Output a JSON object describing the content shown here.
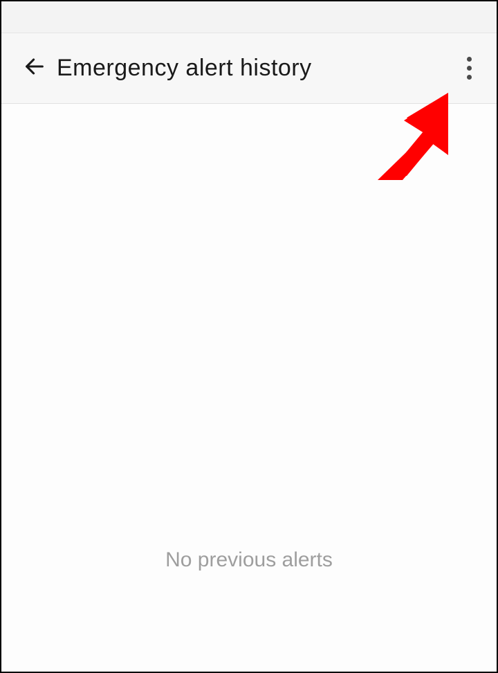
{
  "header": {
    "title": "Emergency alert history"
  },
  "content": {
    "empty_message": "No previous alerts"
  }
}
